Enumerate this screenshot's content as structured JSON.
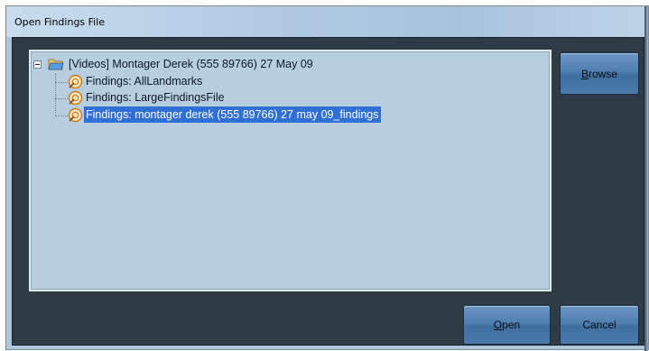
{
  "dialog": {
    "title": "Open Findings File"
  },
  "tree": {
    "root": {
      "label": "[Videos] Montager Derek (555 89766) 27 May 09",
      "icon": "open-folder-icon",
      "expanded": true
    },
    "children": [
      {
        "label": "Findings: AllLandmarks",
        "icon": "findings-icon",
        "selected": false
      },
      {
        "label": "Findings: LargeFindingsFile",
        "icon": "findings-icon",
        "selected": false
      },
      {
        "label": "Findings: montager derek (555 89766) 27 may 09_findings",
        "icon": "findings-icon",
        "selected": true
      }
    ]
  },
  "buttons": {
    "browse": {
      "label": "Browse",
      "mnemonic": "B",
      "rest": "rowse"
    },
    "open": {
      "label": "Open",
      "mnemonic": "O",
      "rest": "pen"
    },
    "cancel": {
      "label": "Cancel"
    }
  },
  "colors": {
    "dialog_background": "#2e3a44",
    "tree_background": "#b7cde0",
    "selection": "#2f6fd6",
    "button": "#4f7fb0",
    "titlebar": "#b2cbe3"
  }
}
